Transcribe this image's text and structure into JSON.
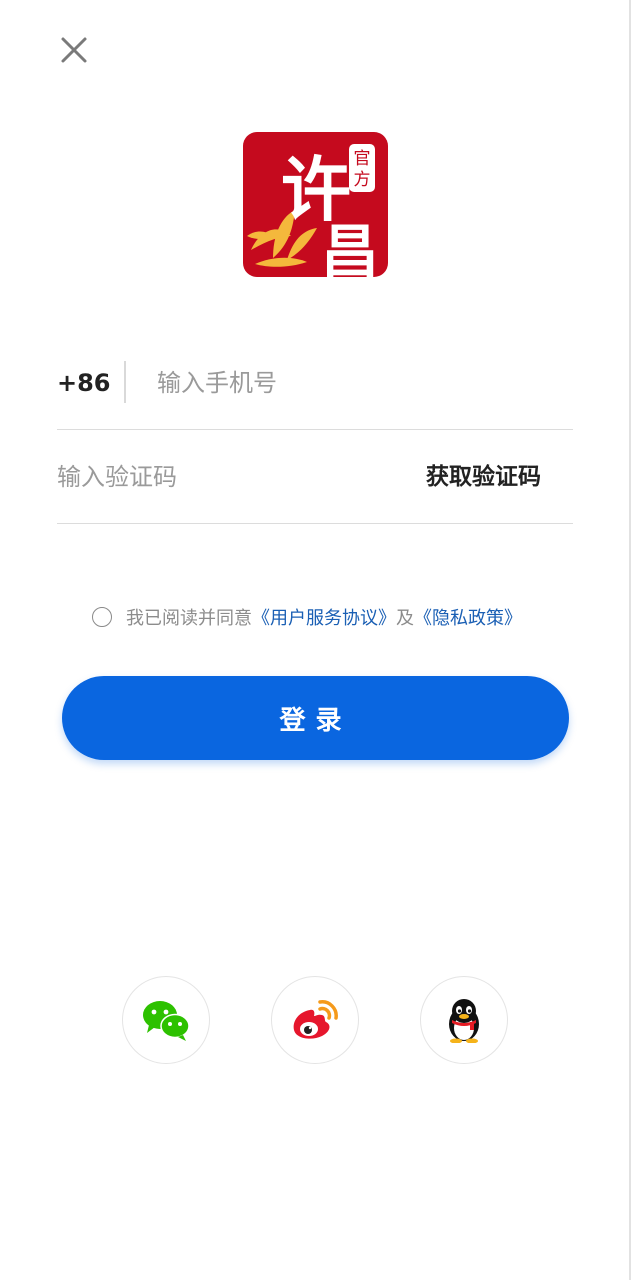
{
  "logo": {
    "chars": [
      "许",
      "昌"
    ],
    "seal": [
      "官",
      "方"
    ],
    "background": "#c50a1e",
    "flower_color": "#f4b83c"
  },
  "phone": {
    "country_code": "+86",
    "placeholder": "输入手机号"
  },
  "verification": {
    "placeholder": "输入验证码",
    "get_code_label": "获取验证码"
  },
  "agreement": {
    "prefix": "我已阅读并同意",
    "user_agreement": "《用户服务协议》",
    "conjunction": "及",
    "privacy_policy": "《隐私政策》"
  },
  "login": {
    "label": "登录",
    "color": "#0a66e0"
  },
  "social_login": [
    {
      "name": "wechat",
      "icon": "wechat-icon",
      "color": "#2dc100"
    },
    {
      "name": "weibo",
      "icon": "weibo-icon",
      "color": "#e6162d"
    },
    {
      "name": "qq",
      "icon": "qq-icon",
      "color": "#111111"
    }
  ]
}
